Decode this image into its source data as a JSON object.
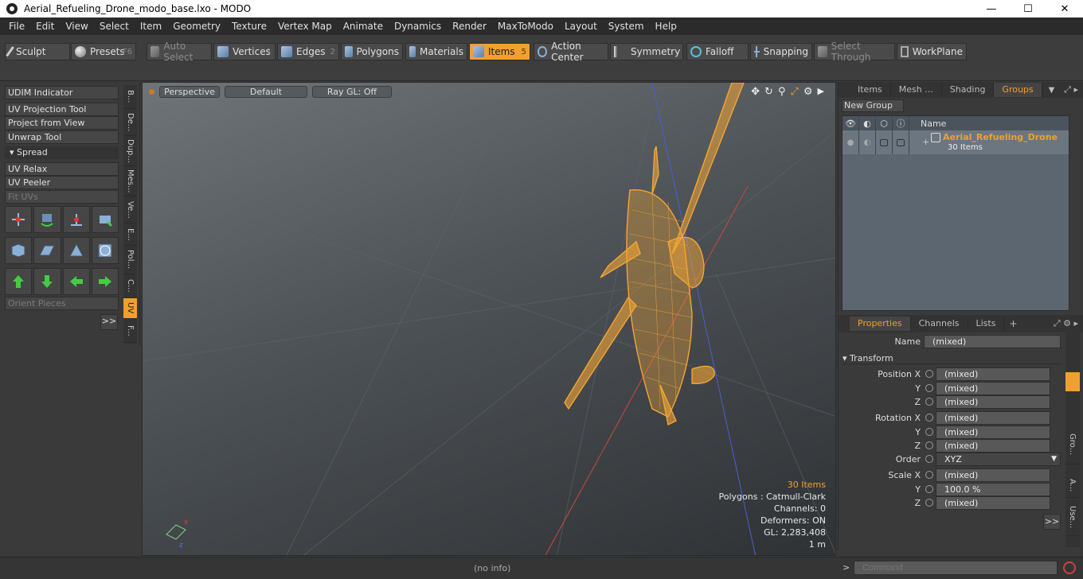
{
  "window": {
    "title": "Aerial_Refueling_Drone_modo_base.lxo - MODO",
    "minimize": "—",
    "maximize": "☐",
    "close": "✕"
  },
  "menu": [
    "File",
    "Edit",
    "View",
    "Select",
    "Item",
    "Geometry",
    "Texture",
    "Vertex Map",
    "Animate",
    "Dynamics",
    "Render",
    "MaxToModo",
    "Layout",
    "System",
    "Help"
  ],
  "toolbar": {
    "sculpt": "Sculpt",
    "presets": "Presets",
    "presets_key": "F6",
    "auto_select": "Auto Select",
    "vertices": "Vertices",
    "vertices_num": "1",
    "edges": "Edges",
    "edges_num": "2",
    "polygons": "Polygons",
    "materials": "Materials",
    "items": "Items",
    "items_num": "5",
    "action_center": "Action Center",
    "symmetry": "Symmetry",
    "falloff": "Falloff",
    "snapping": "Snapping",
    "select_through": "Select Through",
    "workplane": "WorkPlane"
  },
  "leftpanel": {
    "udim": "UDIM Indicator",
    "uv_projection": "UV Projection Tool",
    "project_from_view": "Project from View",
    "unwrap": "Unwrap Tool",
    "spread": "Spread",
    "uv_relax": "UV Relax",
    "uv_peeler": "UV Peeler",
    "fit_uvs": "Fit UVs",
    "orient_pieces": "Orient Pieces",
    "more": ">>",
    "vtabs": [
      "B...",
      "De...",
      "Dup...",
      "Mes...",
      "Ve...",
      "E...",
      "Pol...",
      "C...",
      "UV",
      "F..."
    ]
  },
  "viewport": {
    "view": "Perspective",
    "shading": "Default",
    "raygl": "Ray GL: Off",
    "info_items": "30 Items",
    "info_polygons": "Polygons : Catmull-Clark",
    "info_channels": "Channels: 0",
    "info_deformers": "Deformers: ON",
    "info_gl": "GL: 2,283,408",
    "info_scale": "1 m"
  },
  "itemspanel": {
    "tabs": [
      "Items",
      "Mesh ...",
      "Shading",
      "Groups"
    ],
    "active_tab": "Groups",
    "new_group": "New Group",
    "col_name": "Name",
    "group_name": "Aerial_Refueling_Drone",
    "group_count": "30 Items"
  },
  "propspanel": {
    "tabs": [
      "Properties",
      "Channels",
      "Lists"
    ],
    "name_label": "Name",
    "name_value": "(mixed)",
    "transform": "Transform",
    "position_x": "Position X",
    "rotation_x": "Rotation X",
    "scale_x": "Scale X",
    "y": "Y",
    "z": "Z",
    "order_label": "Order",
    "order_value": "XYZ",
    "mixed": "(mixed)",
    "scale_y": "100.0 %",
    "more": ">>",
    "side_tabs": [
      "Gro...",
      "A...",
      "Use..."
    ]
  },
  "statusbar": {
    "info": "(no info)",
    "command_placeholder": "Command",
    "prompt": ">"
  },
  "colors": {
    "accent": "#f0a030",
    "wire": "#f4a535"
  }
}
